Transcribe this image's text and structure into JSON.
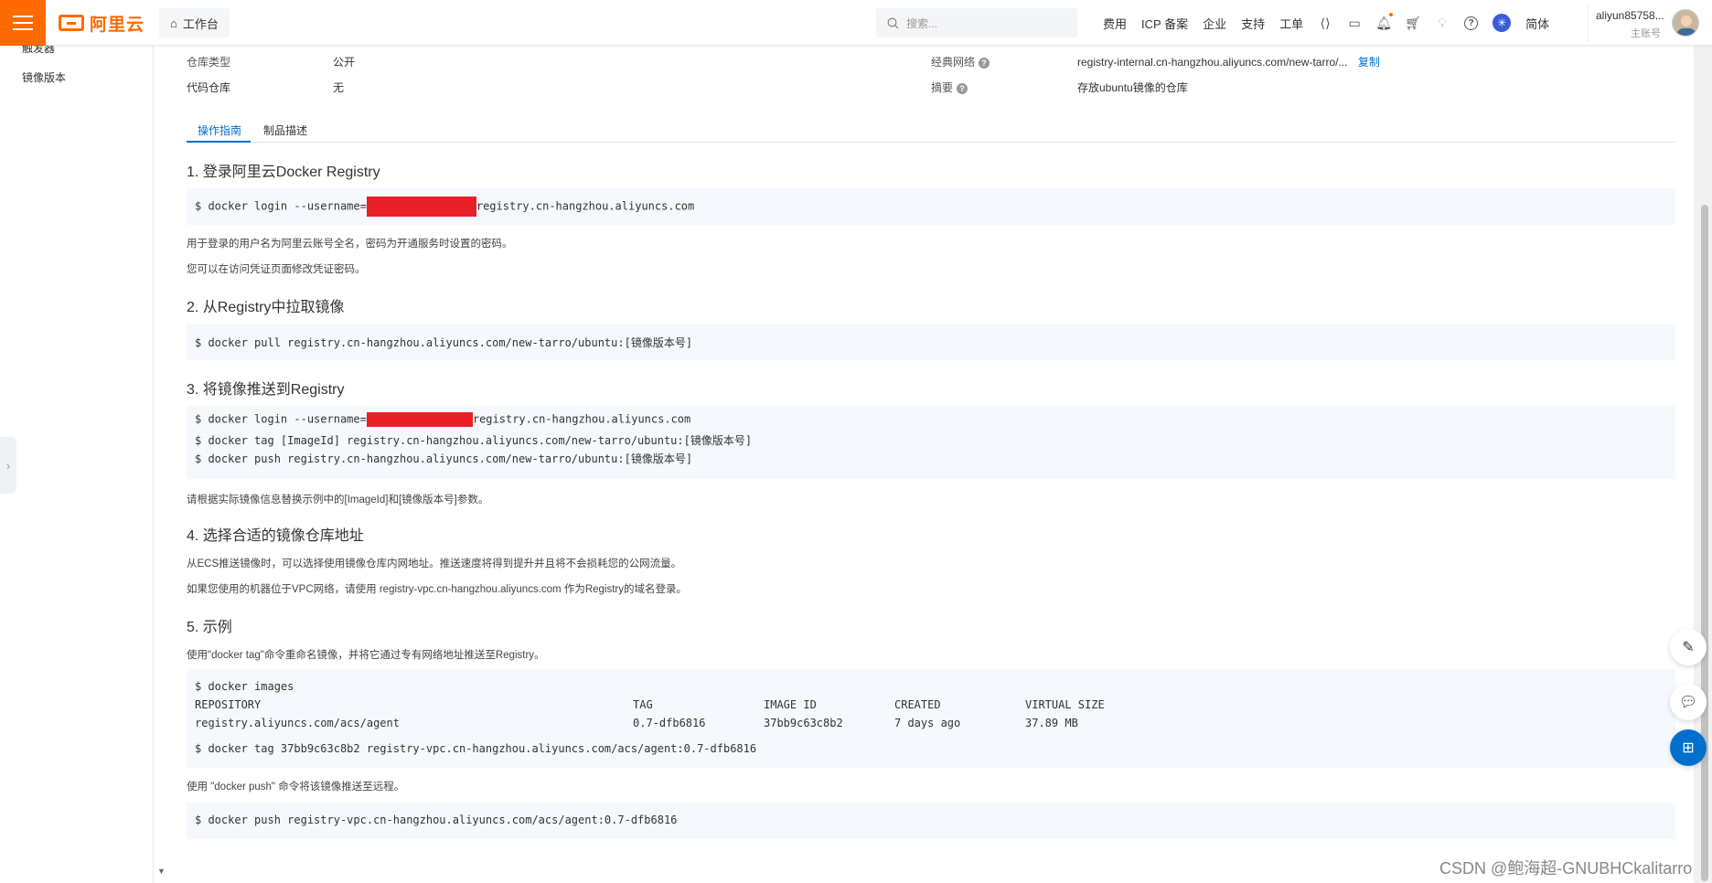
{
  "topbar": {
    "logo_text": "阿里云",
    "workbench_label": "工作台",
    "search_placeholder": "搜索...",
    "nav": [
      "费用",
      "ICP 备案",
      "企业",
      "支持",
      "工单"
    ],
    "lang": "简体",
    "user_name": "aliyun85758...",
    "user_sub": "主账号"
  },
  "sidebar": {
    "items": [
      "触发器",
      "镜像版本"
    ]
  },
  "info": {
    "repo_type_label": "仓库类型",
    "repo_type_value": "公开",
    "code_repo_label": "代码仓库",
    "code_repo_value": "无",
    "network_label": "经典网络",
    "network_value": "registry-internal.cn-hangzhou.aliyuncs.com/new-tarro/...",
    "copy_label": "复制",
    "summary_label": "摘要",
    "summary_value": "存放ubuntu镜像的仓库"
  },
  "tabs": [
    "操作指南",
    "制品描述"
  ],
  "guide": {
    "s1_title": "1. 登录阿里云Docker Registry",
    "s1_code_a": "$ docker login --username=",
    "s1_code_b": "registry.cn-hangzhou.aliyuncs.com",
    "s1_p1": "用于登录的用户名为阿里云账号全名，密码为开通服务时设置的密码。",
    "s1_p2": "您可以在访问凭证页面修改凭证密码。",
    "s2_title": "2. 从Registry中拉取镜像",
    "s2_code": "$ docker pull registry.cn-hangzhou.aliyuncs.com/new-tarro/ubuntu:[镜像版本号]",
    "s3_title": "3. 将镜像推送到Registry",
    "s3_code_1a": "$ docker login --username=",
    "s3_code_1b": "registry.cn-hangzhou.aliyuncs.com",
    "s3_code_2": "$ docker tag [ImageId] registry.cn-hangzhou.aliyuncs.com/new-tarro/ubuntu:[镜像版本号]",
    "s3_code_3": "$ docker push registry.cn-hangzhou.aliyuncs.com/new-tarro/ubuntu:[镜像版本号]",
    "s3_p": "请根据实际镜像信息替换示例中的[ImageId]和[镜像版本号]参数。",
    "s4_title": "4. 选择合适的镜像仓库地址",
    "s4_p1": "从ECS推送镜像时，可以选择使用镜像仓库内网地址。推送速度将得到提升并且将不会损耗您的公网流量。",
    "s4_p2": "如果您使用的机器位于VPC网络，请使用 registry-vpc.cn-hangzhou.aliyuncs.com 作为Registry的域名登录。",
    "s5_title": "5. 示例",
    "s5_p1": "使用\"docker tag\"命令重命名镜像，并将它通过专有网络地址推送至Registry。",
    "s5_images_cmd": "$ docker images",
    "s5_headers": [
      "REPOSITORY",
      "TAG",
      "IMAGE ID",
      "CREATED",
      "VIRTUAL SIZE"
    ],
    "s5_row": [
      "registry.aliyuncs.com/acs/agent",
      "0.7-dfb6816",
      "37bb9c63c8b2",
      "7 days ago",
      "37.89 MB"
    ],
    "s5_tag_cmd": "$ docker tag 37bb9c63c8b2 registry-vpc.cn-hangzhou.aliyuncs.com/acs/agent:0.7-dfb6816",
    "s5_p2": "使用 \"docker push\" 命令将该镜像推送至远程。",
    "s5_push_cmd": "$ docker push registry-vpc.cn-hangzhou.aliyuncs.com/acs/agent:0.7-dfb6816"
  },
  "watermark": "CSDN @鲍海超-GNUBHCkalitarro",
  "colors": {
    "brand": "#ff6a00",
    "link": "#0070cc",
    "redaction": "#e8202a"
  }
}
